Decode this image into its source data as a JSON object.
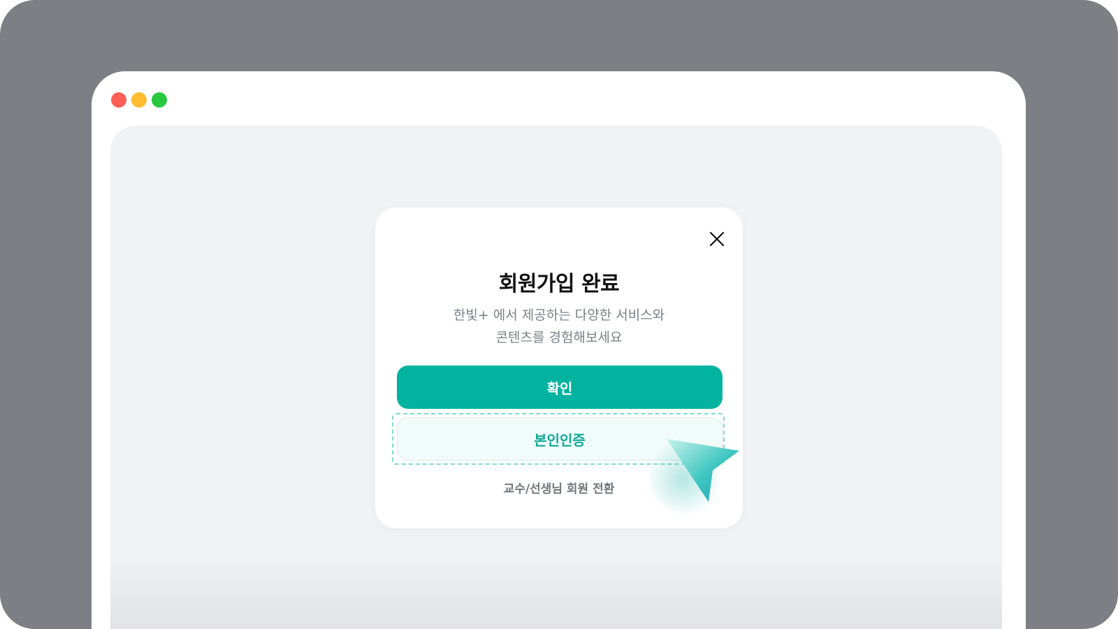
{
  "window": {
    "controls": [
      "close-dot",
      "minimize-dot",
      "maximize-dot"
    ]
  },
  "modal": {
    "title": "회원가입 완료",
    "description_line1": "한빛+ 에서 제공하는 다양한 서비스와",
    "description_line2": "콘텐츠를 경험해보세요",
    "confirm_label": "확인",
    "verify_label": "본인인증",
    "switch_link": "교수/선생님 회원 전환",
    "close_icon": "close-icon"
  },
  "colors": {
    "frame": "#7e7f84",
    "accent": "#02b39f",
    "verify_text": "#0eaa98",
    "dashed_highlight": "#7fd8cf"
  }
}
